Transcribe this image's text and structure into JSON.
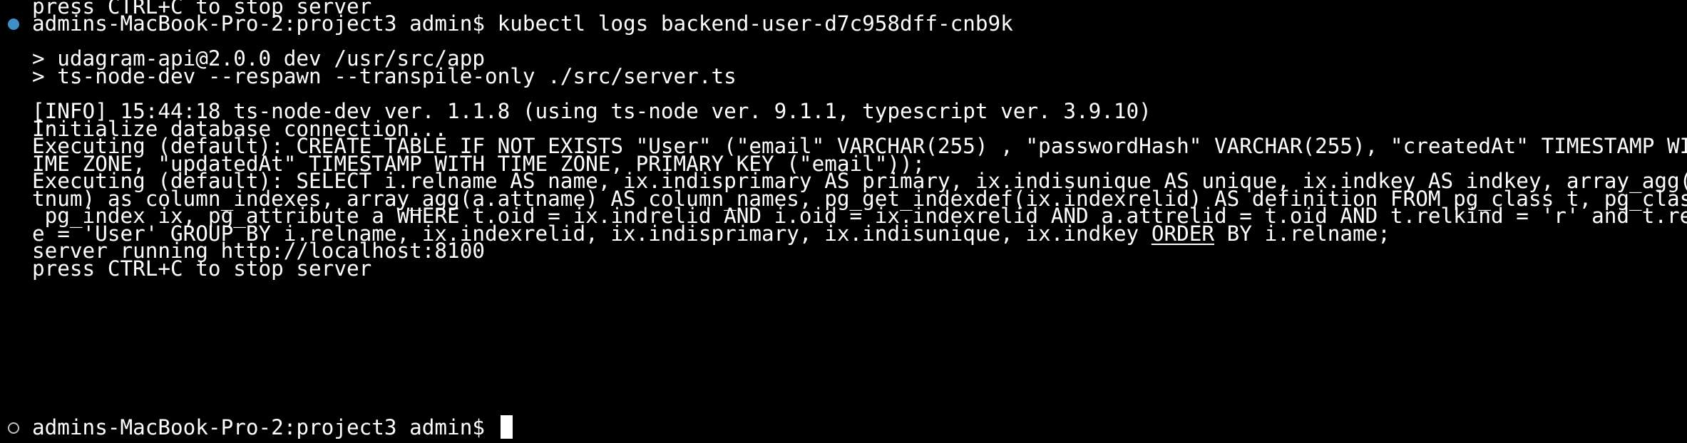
{
  "terminal": {
    "lines": {
      "l0": "press CTRL+C to stop server",
      "l1_prompt": "admins-MacBook-Pro-2:project3 admin$ ",
      "l1_command": "kubectl logs backend-user-d7c958dff-cnb9k",
      "l2": "",
      "l3": "> udagram-api@2.0.0 dev /usr/src/app",
      "l4": "> ts-node-dev --respawn --transpile-only ./src/server.ts",
      "l5": "",
      "l6": "[INFO] 15:44:18 ts-node-dev ver. 1.1.8 (using ts-node ver. 9.1.1, typescript ver. 3.9.10)",
      "l7": "Initialize database connection...",
      "l8": "Executing (default): CREATE TABLE IF NOT EXISTS \"User\" (\"email\" VARCHAR(255) , \"passwordHash\" VARCHAR(255), \"createdAt\" TIMESTAMP WITH T",
      "l9": "IME ZONE, \"updatedAt\" TIMESTAMP WITH TIME ZONE, PRIMARY KEY (\"email\"));",
      "l10": "Executing (default): SELECT i.relname AS name, ix.indisprimary AS primary, ix.indisunique AS unique, ix.indkey AS indkey, array_agg(a.at",
      "l11": "tnum) as column_indexes, array_agg(a.attname) AS column_names, pg_get_indexdef(ix.indexrelid) AS definition FROM pg_class t, pg_class i,",
      "l12": " pg_index ix, pg_attribute a WHERE t.oid = ix.indrelid AND i.oid = ix.indexrelid AND a.attrelid = t.oid AND t.relkind = 'r' and t.relnam",
      "l13_pre": "e = 'User' GROUP BY i.relname, ix.indexrelid, ix.indisprimary, ix.indisunique, ix.indkey ",
      "l13_link": "ORDER",
      "l13_post": " BY i.relname;",
      "l14": "server running http://localhost:8100",
      "l15": "press CTRL+C to stop server",
      "l16_prompt": "admins-MacBook-Pro-2:project3 admin$ "
    },
    "colors": {
      "background": "#000000",
      "text": "#ffffff",
      "success_marker": "#3d8fc6",
      "pending_marker": "#c0c0c0"
    },
    "icons": {
      "completed_command_marker": "filled-circle-icon",
      "current_command_marker": "hollow-circle-icon"
    }
  }
}
